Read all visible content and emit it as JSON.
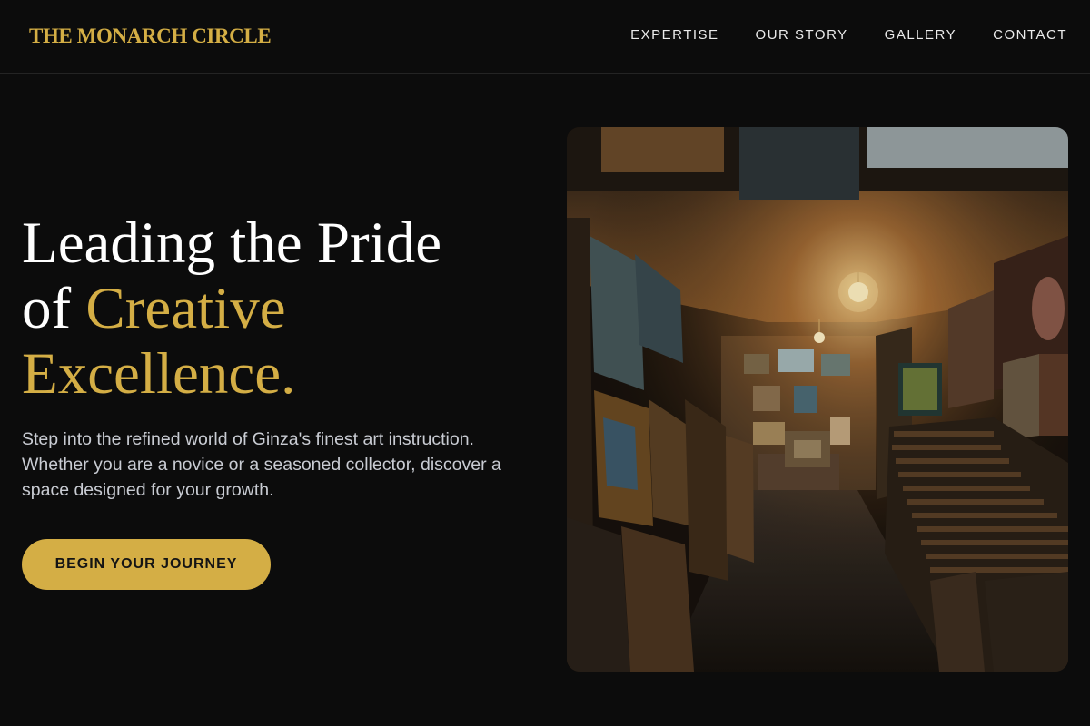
{
  "brand": {
    "name": "THE MONARCH CIRCLE"
  },
  "nav": {
    "items": [
      {
        "label": "EXPERTISE"
      },
      {
        "label": "OUR STORY"
      },
      {
        "label": "GALLERY"
      },
      {
        "label": "CONTACT"
      }
    ]
  },
  "hero": {
    "headline": {
      "line1": "Leading the Pride",
      "line2_prefix": "of ",
      "line2_accent": "Creative",
      "line3_accent": "Excellence."
    },
    "description": "Step into the refined world of Ginza's finest art instruction. Whether you are a novice or a seasoned collector, discover a space designed for your growth.",
    "cta_label": "BEGIN YOUR JOURNEY"
  },
  "colors": {
    "background": "#0c0c0c",
    "accent_gold": "#d4ae45",
    "text_primary": "#ffffff",
    "text_muted": "#c9ccd3"
  },
  "image": {
    "subject": "dimly lit art gallery corridor filled with stacked paintings and a hanging light bulb"
  }
}
